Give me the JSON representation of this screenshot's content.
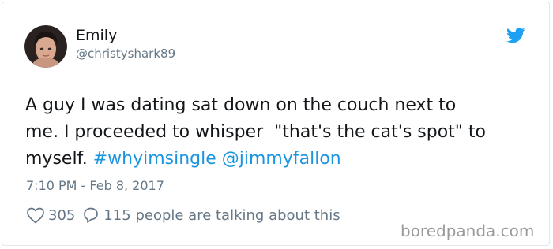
{
  "user": {
    "display_name": "Emily",
    "handle": "@christyshark89"
  },
  "tweet": {
    "lines": [
      "A guy I was dating sat down on the couch next to",
      "me. I proceeded to whisper  \"that's the cat's spot\" to"
    ],
    "line3_prefix": "myself. ",
    "hashtag": "#whyimsingle",
    "mention": "@jimmyfallon",
    "timestamp": "7:10 PM - Feb 8, 2017"
  },
  "actions": {
    "like_count": "305",
    "reply_text": "115 people are talking about this"
  },
  "watermark": "boredpanda.com",
  "colors": {
    "link": "#1b95e0",
    "twitter_blue": "#1da1f2",
    "muted": "#657786"
  },
  "icons": [
    "avatar",
    "twitter-bird-icon",
    "heart-icon",
    "reply-icon"
  ]
}
